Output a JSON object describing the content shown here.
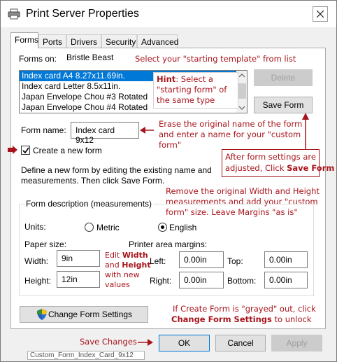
{
  "window": {
    "title": "Print Server Properties",
    "close_label": "✕"
  },
  "tabs": [
    {
      "label": "Forms",
      "active": true
    },
    {
      "label": "Ports"
    },
    {
      "label": "Drivers"
    },
    {
      "label": "Security"
    },
    {
      "label": "Advanced"
    }
  ],
  "forms_on": {
    "label": "Forms on:",
    "server": "Bristle Beast"
  },
  "form_list": {
    "items": [
      "Index card A4 8.27x11.69in.",
      "Index card Letter 8.5x11in.",
      "Japan Envelope Chou #3 Rotated",
      "Japan Envelope Chou #4 Rotated"
    ],
    "selected_index": 0
  },
  "buttons": {
    "delete": "Delete",
    "save_form": "Save Form",
    "change_form_settings": "Change Form Settings",
    "ok": "OK",
    "cancel": "Cancel",
    "apply": "Apply"
  },
  "form_name": {
    "label": "Form name:",
    "value": "Index card 9x12"
  },
  "create_new": {
    "label": "Create a new form",
    "checked": true
  },
  "description_text": [
    "Define a new form by editing the existing name and",
    "measurements. Then click Save Form."
  ],
  "group": {
    "title": "Form description (measurements)",
    "units_label": "Units:",
    "metric_label": "Metric",
    "english_label": "English",
    "selected_unit": "English",
    "paper_size_label": "Paper size:",
    "margins_label": "Printer area margins:",
    "width_label": "Width:",
    "width_value": "9in",
    "height_label": "Height:",
    "height_value": "12in",
    "left_label": "Left:",
    "left_value": "0.00in",
    "right_label": "Right:",
    "right_value": "0.00in",
    "top_label": "Top:",
    "top_value": "0.00in",
    "bottom_label": "Bottom:",
    "bottom_value": "0.00in"
  },
  "annotations": {
    "select_template": "Select your \"starting template\" from list",
    "hint_label": "Hint",
    "hint_text_1": ":  Select a",
    "hint_text_2": "\"starting form\" of",
    "hint_text_3": "the same type",
    "erase_1": "Erase the original name of the form",
    "erase_2": "and enter a name for your \"custom",
    "erase_3": "form\"",
    "after_1": "After form settings are",
    "after_2": "adjusted, Click ",
    "after_bold": "Save Form",
    "remove_1": "Remove the original Width and Height",
    "remove_2": "measurements and add your \"custom",
    "remove_3": "form\" size.  Leave Margins \"as is\"",
    "edit_1": "Edit ",
    "edit_width": "Width",
    "edit_and": "and ",
    "edit_height": "Height",
    "edit_3": "with new",
    "edit_4": "values",
    "grayed_1": "If Create Form is \"grayed\" out, click",
    "grayed_bold": "Change Form Settings",
    "grayed_2": " to unlock",
    "save_changes": "Save Changes"
  },
  "status_caption": "Custom_Form_Index_Card_9x12",
  "colors": {
    "annotation_red": "#a8141b",
    "selection_blue": "#0078d7"
  }
}
